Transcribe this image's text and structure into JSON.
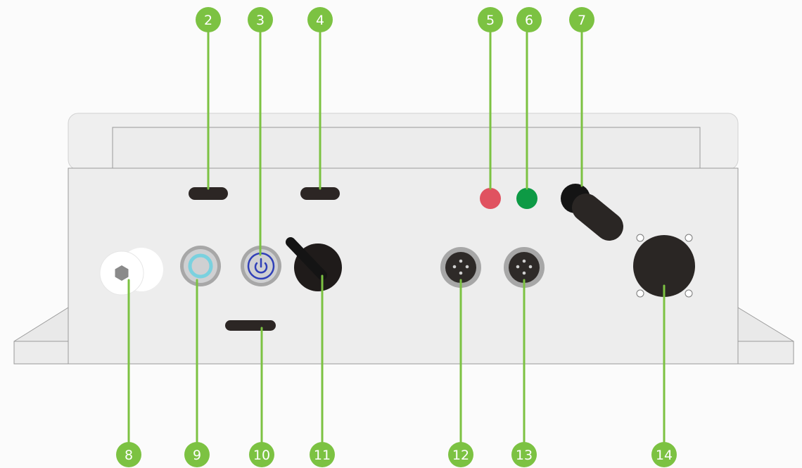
{
  "colors": {
    "callout": "#7cc242",
    "leader": "#7cc242",
    "housing": "#ededed",
    "housing_stroke": "#9a9a9a",
    "led_red": "#e05260",
    "led_green": "#0d9a45",
    "power_ring": "#3040b8",
    "light_ring": "#7ad1df"
  },
  "callouts": [
    {
      "id": "c2",
      "label": "2",
      "target": "slot-2"
    },
    {
      "id": "c3",
      "label": "3",
      "target": "power-button"
    },
    {
      "id": "c4",
      "label": "4",
      "target": "slot-4"
    },
    {
      "id": "c5",
      "label": "5",
      "target": "red-led"
    },
    {
      "id": "c6",
      "label": "6",
      "target": "green-led"
    },
    {
      "id": "c7",
      "label": "7",
      "target": "antenna"
    },
    {
      "id": "c8",
      "label": "8",
      "target": "white-connector"
    },
    {
      "id": "c9",
      "label": "9",
      "target": "illuminated-button"
    },
    {
      "id": "c10",
      "label": "10",
      "target": "slot-10"
    },
    {
      "id": "c11",
      "label": "11",
      "target": "rotary-switch"
    },
    {
      "id": "c12",
      "label": "12",
      "target": "connector-12"
    },
    {
      "id": "c13",
      "label": "13",
      "target": "connector-13"
    },
    {
      "id": "c14",
      "label": "14",
      "target": "large-connector"
    }
  ]
}
